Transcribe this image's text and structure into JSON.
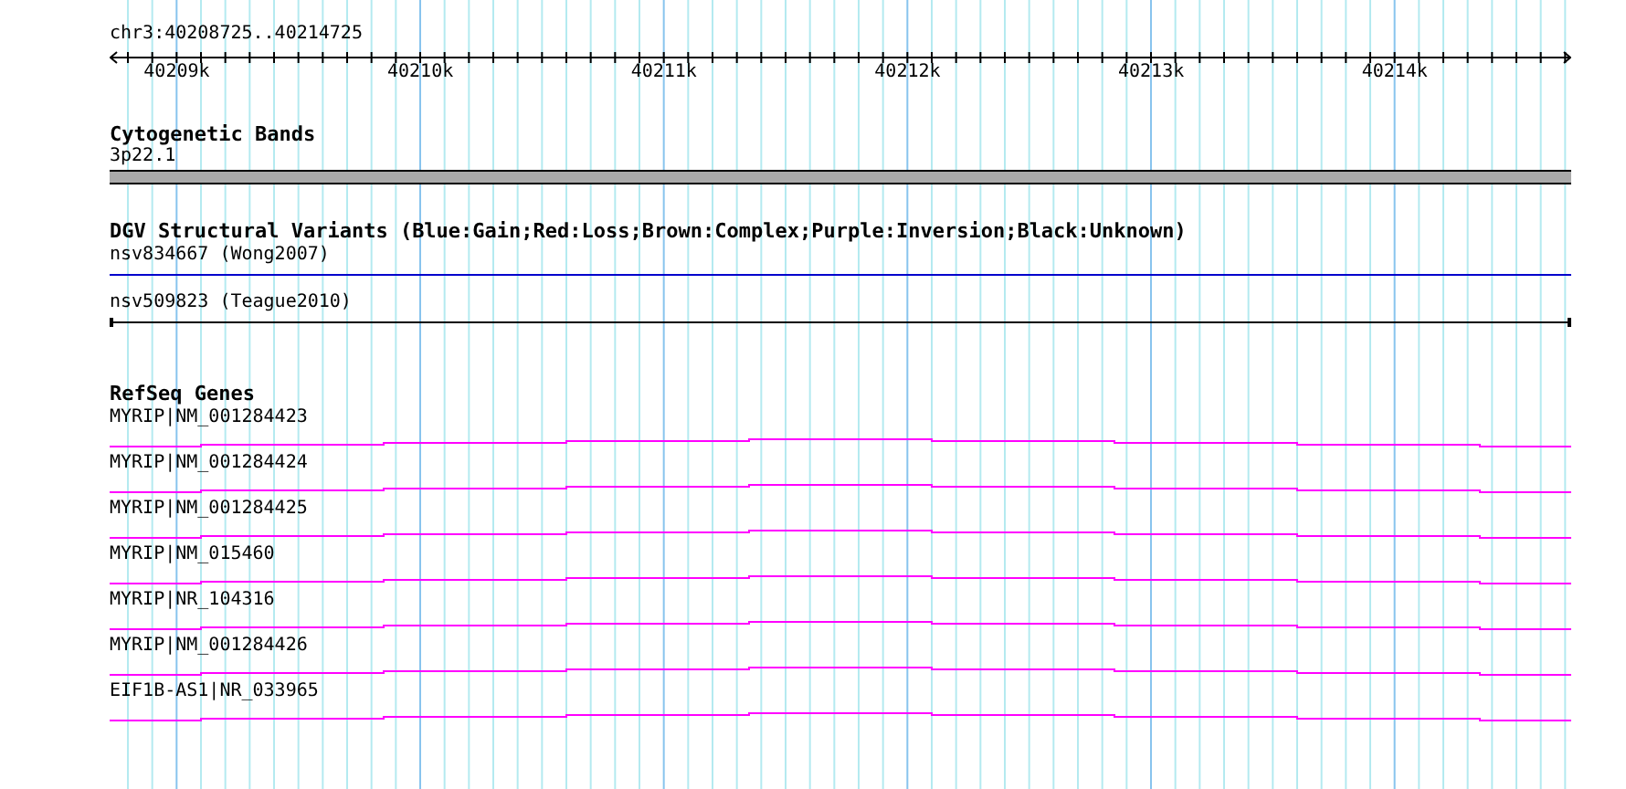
{
  "ruler": {
    "location": "chr3:40208725..40214725",
    "ticks": [
      "40209k",
      "40210k",
      "40211k",
      "40212k",
      "40213k",
      "40214k"
    ]
  },
  "tracks": [
    {
      "kind": "bands",
      "title": "Cytogenetic Bands",
      "features": [
        {
          "label": "3p22.1"
        }
      ]
    },
    {
      "kind": "variants",
      "title": "DGV Structural Variants (Blue:Gain;Red:Loss;Brown:Complex;Purple:Inversion;Black:Unknown)",
      "features": [
        {
          "label": "nsv834667 (Wong2007)",
          "color": "#0000cc"
        },
        {
          "label": "nsv509823 (Teague2010)",
          "color": "#000000"
        }
      ]
    },
    {
      "kind": "genes",
      "title": "RefSeq Genes",
      "features": [
        {
          "label": "MYRIP|NM_001284423"
        },
        {
          "label": "MYRIP|NM_001284424"
        },
        {
          "label": "MYRIP|NM_001284425"
        },
        {
          "label": "MYRIP|NM_015460"
        },
        {
          "label": "MYRIP|NR_104316"
        },
        {
          "label": "MYRIP|NM_001284426"
        },
        {
          "label": "EIF1B-AS1|NR_033965"
        }
      ]
    }
  ]
}
